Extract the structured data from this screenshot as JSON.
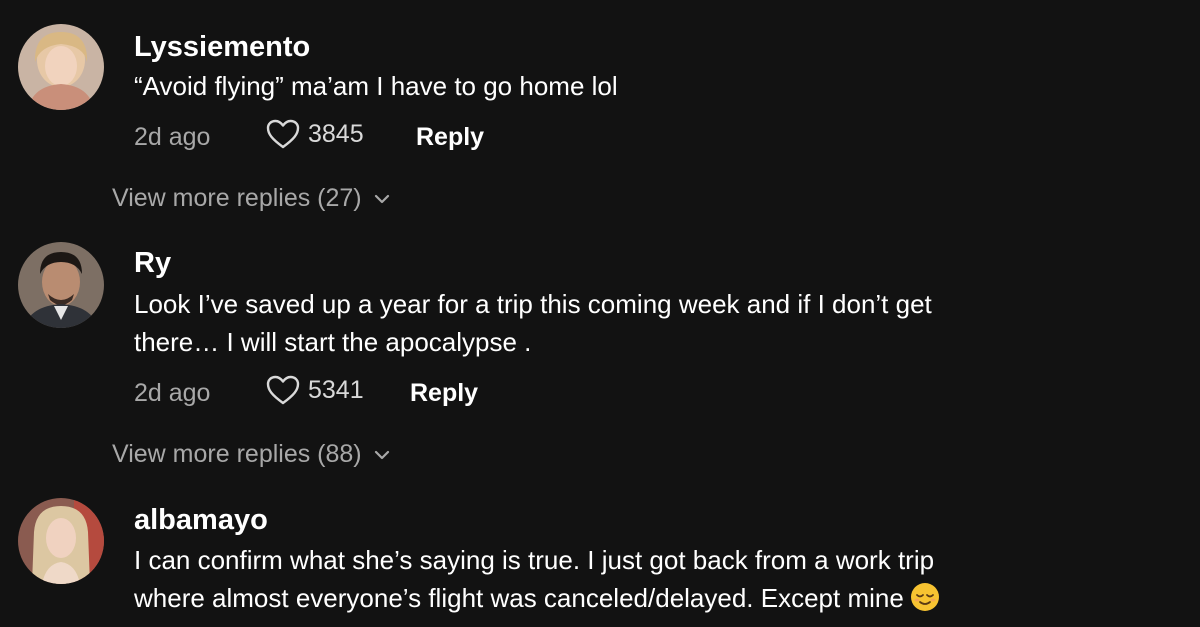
{
  "comments": [
    {
      "username": "Lyssiemento",
      "lines": [
        "“Avoid flying” ma’am I have to go home lol"
      ],
      "time": "2d ago",
      "likes": "3845",
      "reply_label": "Reply",
      "view_more": "View more replies (27)",
      "avatar_icon": "user-photo-blonde-woman"
    },
    {
      "username": "Ry",
      "lines": [
        "Look I’ve saved up a year for a trip this coming week and if I don’t get",
        "there… I will start the apocalypse ."
      ],
      "time": "2d ago",
      "likes": "5341",
      "reply_label": "Reply",
      "view_more": "View more replies (88)",
      "avatar_icon": "user-photo-man-portrait"
    },
    {
      "username": "albamayo",
      "lines": [
        "I can confirm what she’s saying is true. I just got back from a work trip",
        "where almost everyone’s flight was canceled/delayed. Except mine"
      ],
      "emoji": "relieved-face-emoji",
      "avatar_icon": "user-photo-blonde-woman-2"
    }
  ],
  "colors": {
    "background": "#121212",
    "primary_text": "#ffffff",
    "secondary_text": "#a8a8a8",
    "emoji_yellow": "#f7c331"
  }
}
